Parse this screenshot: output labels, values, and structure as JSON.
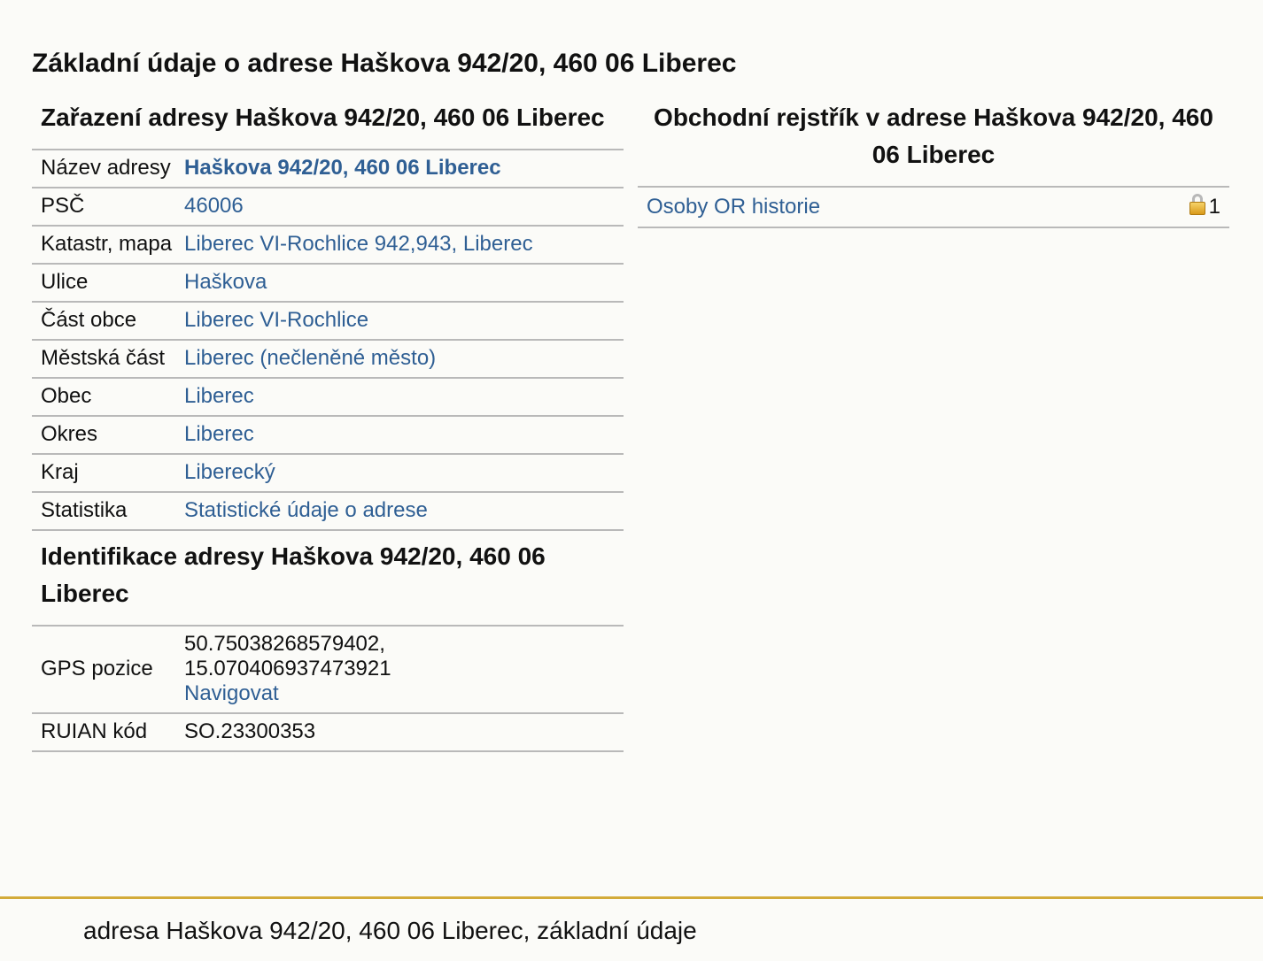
{
  "page": {
    "title": "Základní údaje o adrese Haškova 942/20, 460 06 Liberec"
  },
  "classification": {
    "title": "Zařazení adresy Haškova 942/20, 460 06 Liberec",
    "rows": [
      {
        "label": "Název adresy",
        "value": "Haškova 942/20, 460 06 Liberec"
      },
      {
        "label": "PSČ",
        "value": "46006"
      },
      {
        "label": "Katastr, mapa",
        "value": "Liberec VI-Rochlice 942,943, Liberec"
      },
      {
        "label": "Ulice",
        "value": "Haškova"
      },
      {
        "label": "Část obce",
        "value": "Liberec VI-Rochlice"
      },
      {
        "label": "Městská část",
        "value": "Liberec (nečleněné město)"
      },
      {
        "label": "Obec",
        "value": "Liberec"
      },
      {
        "label": "Okres",
        "value": "Liberec"
      },
      {
        "label": "Kraj",
        "value": "Liberecký"
      },
      {
        "label": "Statistika",
        "value": "Statistické údaje o adrese"
      }
    ]
  },
  "identification": {
    "title": "Identifikace adresy Haškova 942/20, 460 06 Liberec",
    "gps": {
      "label": "GPS pozice",
      "lat": "50.75038268579402,",
      "lon": "15.070406937473921",
      "navigate": "Navigovat"
    },
    "ruian": {
      "label": "RUIAN kód",
      "value": "SO.23300353"
    }
  },
  "business_register": {
    "title": "Obchodní rejstřík v adrese Haškova 942/20, 460 06 Liberec",
    "rows": [
      {
        "label": "Osoby OR historie",
        "count": "1",
        "icon": "lock-icon"
      }
    ]
  },
  "footer": {
    "text": "adresa Haškova 942/20, 460 06 Liberec, základní údaje",
    "accent_color": "#d3ab3a"
  },
  "colors": {
    "link": "#2f5f94",
    "background": "#fbfbf8",
    "divider": "#b9b9b9"
  }
}
